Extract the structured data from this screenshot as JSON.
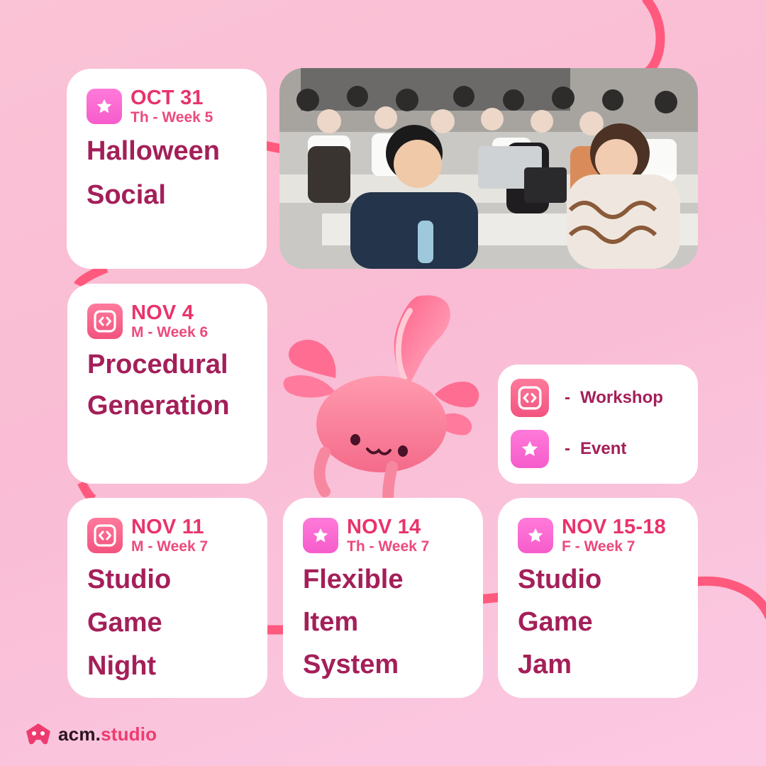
{
  "colors": {
    "event_badge": "#f65ccb",
    "workshop_badge": "#f2537f",
    "date_text": "#e9336b",
    "title_text": "#a41f59",
    "path_line": "#ff5a7e"
  },
  "events": [
    {
      "type": "event",
      "icon": "star-icon",
      "date": "OCT 31",
      "sub": "Th - Week 5",
      "title_lines": [
        "Halloween",
        "Social"
      ]
    },
    {
      "type": "workshop",
      "icon": "code-brackets-icon",
      "date": "NOV 4",
      "sub": "M - Week 6",
      "title_lines": [
        "Procedural",
        "Generation"
      ]
    },
    {
      "type": "workshop",
      "icon": "code-brackets-icon",
      "date": "NOV 11",
      "sub": "M - Week 7",
      "title_lines": [
        "Studio",
        "Game",
        "Night"
      ]
    },
    {
      "type": "event",
      "icon": "star-icon",
      "date": "NOV 14",
      "sub": "Th - Week 7",
      "title_lines": [
        "Flexible",
        "Item",
        "System"
      ]
    },
    {
      "type": "event",
      "icon": "star-icon",
      "date": "NOV 15-18",
      "sub": "F - Week 7",
      "title_lines": [
        "Studio",
        "Game",
        "Jam"
      ]
    }
  ],
  "legend": {
    "dash": "-",
    "workshop_label": "Workshop",
    "event_label": "Event"
  },
  "logo": {
    "icon": "gamepad-icon",
    "name_part1": "acm.",
    "name_part2": "studio"
  }
}
